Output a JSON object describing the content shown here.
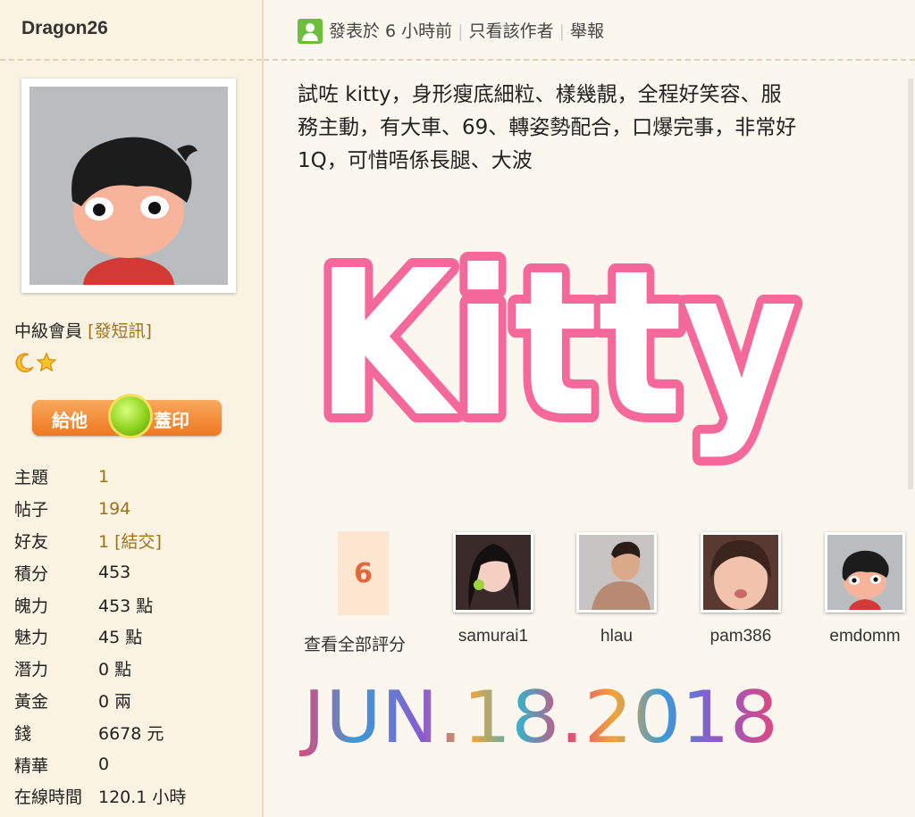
{
  "sidebar": {
    "username": "Dragon26",
    "rank_label": "中級會員",
    "pm_link": "[發短訊]",
    "stamp_left": "給他",
    "stamp_right": "蓋印",
    "stats": [
      {
        "label": "主題",
        "value": "1"
      },
      {
        "label": "帖子",
        "value": "194"
      },
      {
        "label": "好友",
        "value": "1",
        "link": "[結交]"
      },
      {
        "label": "積分",
        "value": "453"
      },
      {
        "label": "魄力",
        "value": "453 點"
      },
      {
        "label": "魅力",
        "value": "45 點"
      },
      {
        "label": "潛力",
        "value": "0 點"
      },
      {
        "label": "黃金",
        "value": "0 兩"
      },
      {
        "label": "錢",
        "value": "6678 元"
      },
      {
        "label": "精華",
        "value": "0"
      },
      {
        "label": "在線時間",
        "value": "120.1 小時"
      }
    ]
  },
  "post": {
    "posted": "發表於 6 小時前",
    "only_author": "只看該作者",
    "report": "舉報",
    "body_line1": "試咗  kitty，身形瘦底細粒、樣幾靚，全程好笑容、服",
    "body_line2": "務主動，有大車、69、轉姿勢配合，口爆完事，非常好",
    "body_line3": "1Q，可惜唔係長腿、大波",
    "kitty_text": "Kitty",
    "date_text": "JUN.18.2018"
  },
  "ratings": {
    "total": "6",
    "caption": "查看全部評分",
    "raters": [
      "samurai1",
      "hlau",
      "pam386",
      "emdomm"
    ]
  },
  "colors": {
    "kitty_pink": "#f4699a",
    "link_gold": "#a0701a",
    "rating_orange": "#e2673b"
  }
}
